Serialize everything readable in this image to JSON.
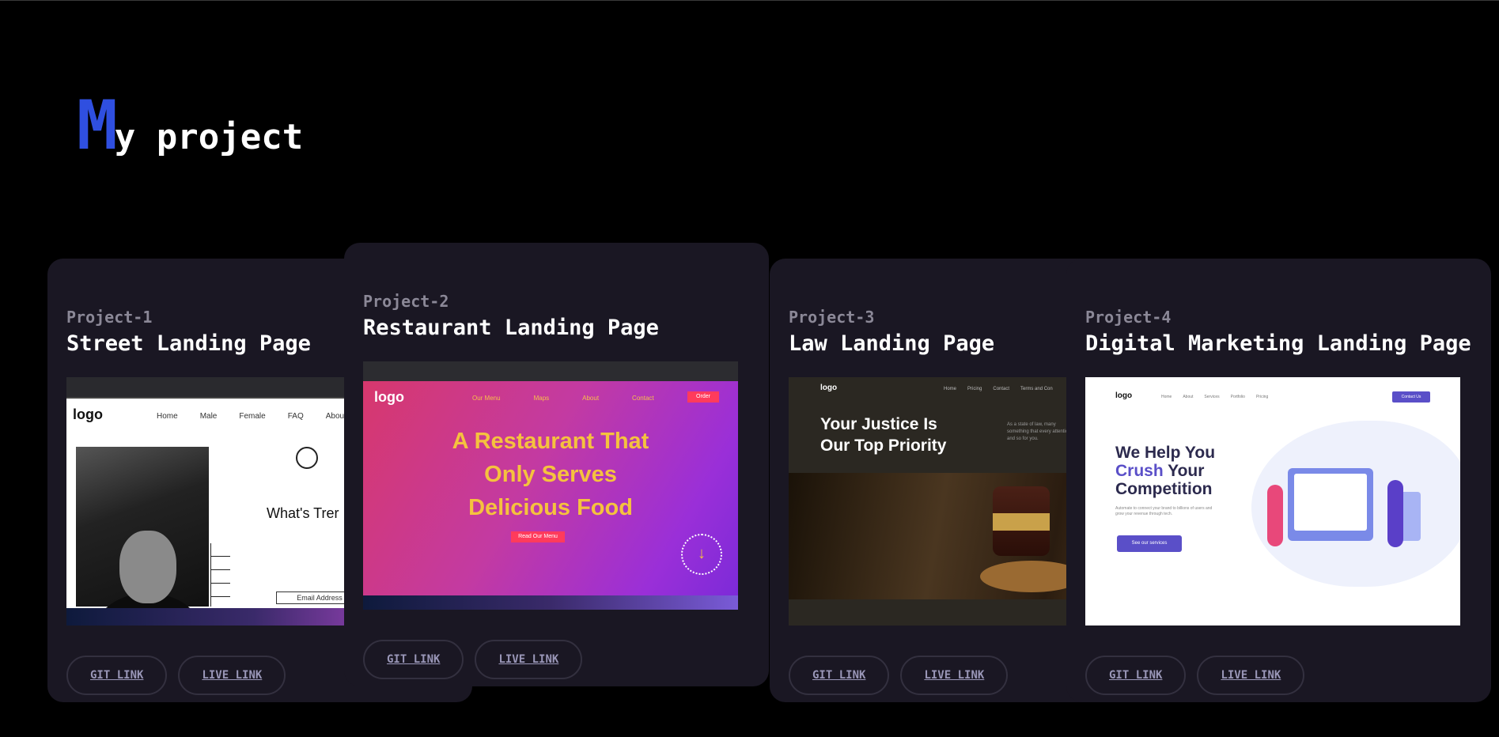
{
  "page": {
    "heading_initial": "M",
    "heading_rest": "y project"
  },
  "projects": [
    {
      "number": "Project-1",
      "title": "Street Landing Page",
      "git_label": "GIT LINK",
      "live_label": "LIVE LINK",
      "preview": {
        "logo": "logo",
        "nav": [
          "Home",
          "Male",
          "Female",
          "FAQ",
          "About"
        ],
        "headline": "What's Trer",
        "button": "Email Address"
      }
    },
    {
      "number": "Project-2",
      "title": "Restaurant Landing Page",
      "git_label": "GIT LINK",
      "live_label": "LIVE LINK",
      "preview": {
        "logo": "logo",
        "nav": [
          "Our Menu",
          "Maps",
          "About",
          "Contact"
        ],
        "order": "Order",
        "hero": [
          "A Restaurant That",
          "Only Serves",
          "Delicious Food"
        ],
        "menu_button": "Read Our Menu",
        "scroll_icon": "arrow-down-icon"
      }
    },
    {
      "number": "Project-3",
      "title": "Law Landing Page",
      "git_label": "GIT LINK",
      "live_label": "LIVE LINK",
      "preview": {
        "logo": "logo",
        "nav": [
          "Home",
          "Pricing",
          "Contact",
          "Terms and Con"
        ],
        "hero": [
          "Your Justice Is",
          "Our Top Priority"
        ],
        "paragraph": "As a state of law, many something that every attention to, and so for you."
      }
    },
    {
      "number": "Project-4",
      "title": "Digital Marketing Landing Page",
      "git_label": "GIT LINK",
      "live_label": "LIVE LINK",
      "preview": {
        "logo": "logo",
        "nav": [
          "Home",
          "About",
          "Services",
          "Portfolio",
          "Pricing"
        ],
        "contact": "Contact Us",
        "hero_1": "We Help You",
        "hero_2a": "Crush",
        "hero_2b": " Your",
        "hero_3": "Competition",
        "subtext": "Automate to connect your brand to billions of users and grow your revenue through tech.",
        "services_button": "See our services"
      }
    }
  ],
  "colors": {
    "background": "#000000",
    "card": "#1a1723",
    "accent": "#2f4fe0",
    "link": "#9a97b8"
  }
}
